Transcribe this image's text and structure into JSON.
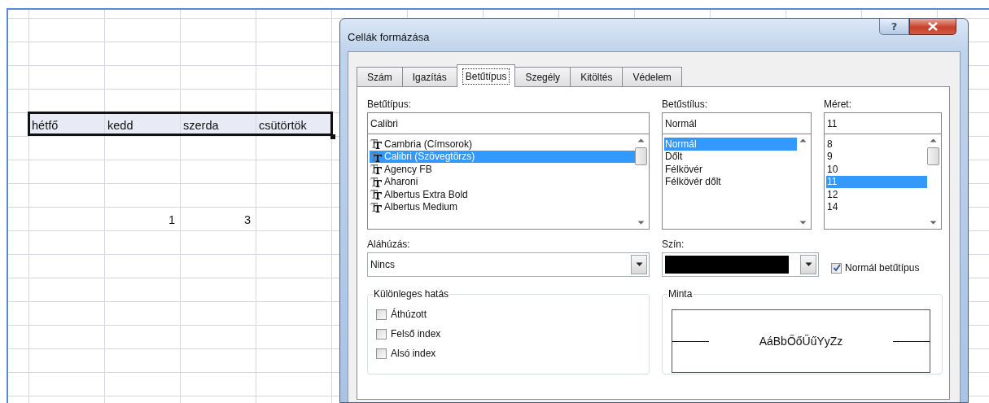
{
  "sheet": {
    "rows": [
      {
        "cells": [
          {
            "kind": "text",
            "text": "hétfő",
            "selected": true
          },
          {
            "kind": "text",
            "text": "kedd",
            "selected": true
          },
          {
            "kind": "text",
            "text": "szerda",
            "selected": true
          },
          {
            "kind": "text",
            "text": "csütörtök",
            "selected": true
          }
        ]
      },
      {
        "cells": [
          {
            "kind": "blank"
          },
          {
            "kind": "number",
            "text": "1",
            "selected": false
          },
          {
            "kind": "number",
            "text": "3",
            "selected": false
          }
        ]
      }
    ]
  },
  "dialog": {
    "title": "Cellák formázása",
    "help_button": "?",
    "tabs": [
      {
        "label": "Szám",
        "selected": false
      },
      {
        "label": "Igazítás",
        "selected": false
      },
      {
        "label": "Betűtípus",
        "selected": true
      },
      {
        "label": "Szegély",
        "selected": false
      },
      {
        "label": "Kitöltés",
        "selected": false
      },
      {
        "label": "Védelem",
        "selected": false
      }
    ],
    "font": {
      "label": "Betűtípus:",
      "value": "Calibri",
      "items": [
        {
          "text": "Cambria (Címsorok)",
          "selected": false
        },
        {
          "text": "Calibri (Szövegtörzs)",
          "selected": true
        },
        {
          "text": "Agency FB",
          "selected": false
        },
        {
          "text": "Aharoni",
          "selected": false
        },
        {
          "text": "Albertus Extra Bold",
          "selected": false
        },
        {
          "text": "Albertus Medium",
          "selected": false
        }
      ]
    },
    "style": {
      "label": "Betűstílus:",
      "value": "Normál",
      "items": [
        {
          "text": "Normál",
          "selected": true
        },
        {
          "text": "Dőlt",
          "selected": false
        },
        {
          "text": "Félkövér",
          "selected": false
        },
        {
          "text": "Félkövér dőlt",
          "selected": false
        }
      ]
    },
    "size": {
      "label": "Méret:",
      "value": "11",
      "items": [
        {
          "text": "8",
          "selected": false
        },
        {
          "text": "9",
          "selected": false
        },
        {
          "text": "10",
          "selected": false
        },
        {
          "text": "11",
          "selected": true
        },
        {
          "text": "12",
          "selected": false
        },
        {
          "text": "14",
          "selected": false
        }
      ]
    },
    "underline": {
      "label": "Aláhúzás:",
      "value": "Nincs"
    },
    "color": {
      "label": "Szín:",
      "color": "#000000"
    },
    "normal_font": {
      "label": "Normál betűtípus",
      "checked": true
    },
    "effects": {
      "title": "Különleges hatás",
      "options": [
        {
          "label": "Áthúzott",
          "checked": false
        },
        {
          "label": "Felső index",
          "checked": false
        },
        {
          "label": "Alsó index",
          "checked": false
        }
      ]
    },
    "preview": {
      "title": "Minta",
      "sample": "AáBbŐőŰűYyZz"
    }
  }
}
